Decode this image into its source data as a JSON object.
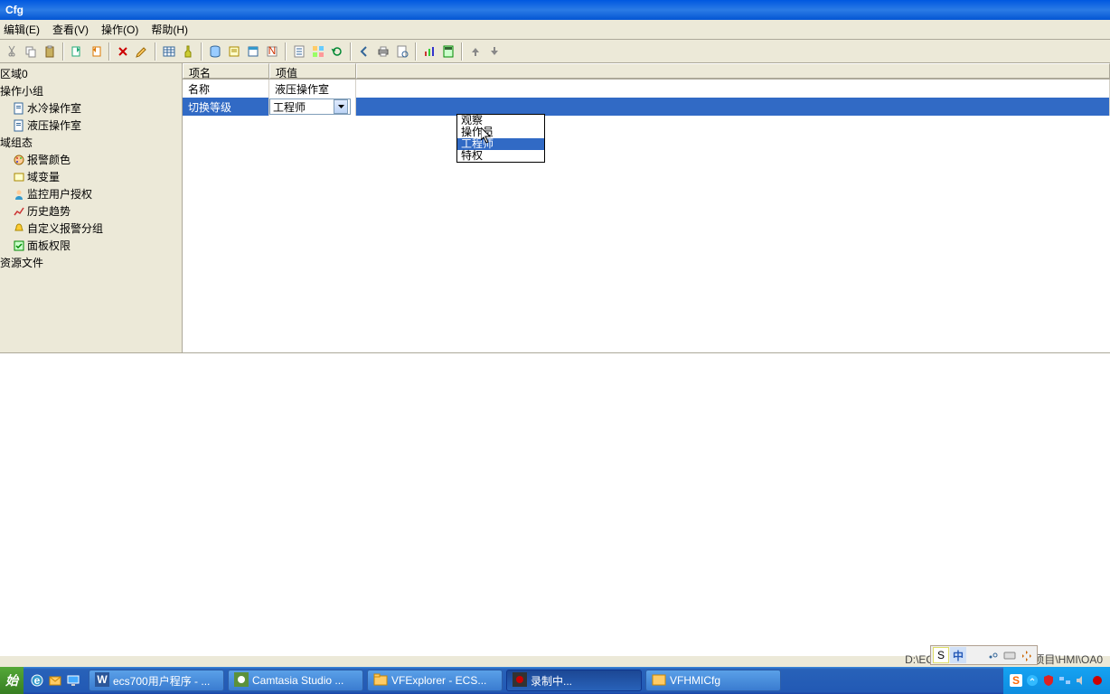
{
  "window": {
    "title": "Cfg"
  },
  "menu": {
    "edit": "编辑(E)",
    "view": "查看(V)",
    "operation": "操作(O)",
    "help": "帮助(H)"
  },
  "tree": {
    "items": [
      {
        "label": "区域0",
        "indent": 0
      },
      {
        "label": "操作小组",
        "indent": 0
      },
      {
        "label": "水冷操作室",
        "indent": 1,
        "icon": "doc"
      },
      {
        "label": "液压操作室",
        "indent": 1,
        "icon": "doc"
      },
      {
        "label": "域组态",
        "indent": 0
      },
      {
        "label": "报警颜色",
        "indent": 1,
        "icon": "palette"
      },
      {
        "label": "域变量",
        "indent": 1,
        "icon": "var"
      },
      {
        "label": "监控用户授权",
        "indent": 1,
        "icon": "user"
      },
      {
        "label": "历史趋势",
        "indent": 1,
        "icon": "chart"
      },
      {
        "label": "自定义报警分组",
        "indent": 1,
        "icon": "bell"
      },
      {
        "label": "面板权限",
        "indent": 1,
        "icon": "panel"
      },
      {
        "label": "资源文件",
        "indent": 0
      }
    ]
  },
  "grid": {
    "headers": {
      "name": "项名",
      "value": "项值"
    },
    "rows": [
      {
        "name": "名称",
        "value": "液压操作室"
      },
      {
        "name": "切换等级",
        "value": "工程师",
        "selected": true,
        "combo": true
      }
    ]
  },
  "dropdown": {
    "options": [
      "观察",
      "操作员",
      "工程师",
      "特权"
    ],
    "hover_index": 2
  },
  "status": {
    "path": "D:\\ECSDATA\\ECS700视频项目\\HMI\\OA0"
  },
  "ime": {
    "s": "S",
    "mode": "中"
  },
  "taskbar": {
    "start": "始",
    "tasks": [
      {
        "label": "ecs700用户程序 - ...",
        "type": "word"
      },
      {
        "label": "Camtasia Studio ...",
        "type": "camtasia"
      },
      {
        "label": "VFExplorer - ECS...",
        "type": "explorer"
      },
      {
        "label": "录制中...",
        "type": "recorder",
        "active": true
      },
      {
        "label": "VFHMICfg",
        "type": "app"
      }
    ]
  }
}
